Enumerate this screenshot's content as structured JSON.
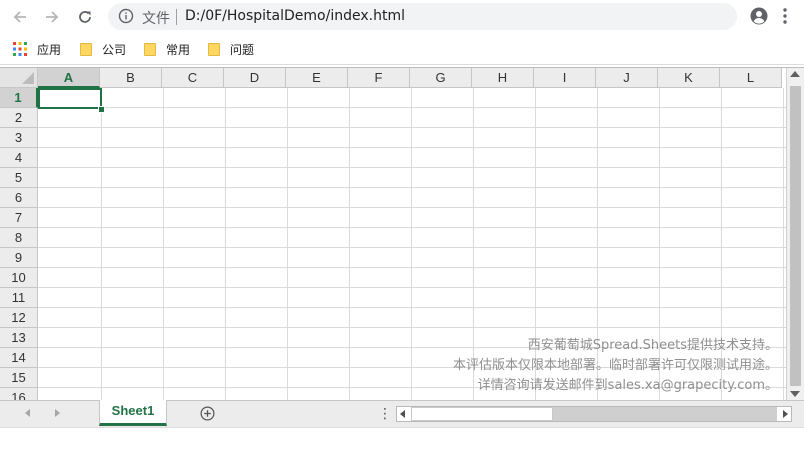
{
  "browser": {
    "scheme_label": "文件",
    "url": "D:/0F/HospitalDemo/index.html",
    "icons": [
      "back-icon",
      "forward-icon",
      "reload-icon",
      "info-icon",
      "star-icon",
      "profile-icon",
      "menu-icon",
      "apps-icon",
      "folder-icon"
    ]
  },
  "bookmarks": {
    "apps_label": "应用",
    "items": [
      {
        "label": "公司"
      },
      {
        "label": "常用"
      },
      {
        "label": "问题"
      }
    ]
  },
  "spreadsheet": {
    "columns": [
      "A",
      "B",
      "C",
      "D",
      "E",
      "F",
      "G",
      "H",
      "I",
      "J",
      "K",
      "L"
    ],
    "rows": [
      "1",
      "2",
      "3",
      "4",
      "5",
      "6",
      "7",
      "8",
      "9",
      "10",
      "11",
      "12",
      "13",
      "14",
      "15",
      "16"
    ],
    "active_cell": "A1",
    "accent_color": "#217346",
    "watermark": [
      "西安葡萄城Spread.Sheets提供技术支持。",
      "本评估版本仅限本地部署。临时部署许可仅限测试用途。",
      "详情咨询请发送邮件到sales.xa@grapecity.com。"
    ]
  },
  "tabs": {
    "sheets": [
      {
        "label": "Sheet1"
      }
    ],
    "active": "Sheet1",
    "more_label": "⋮"
  }
}
